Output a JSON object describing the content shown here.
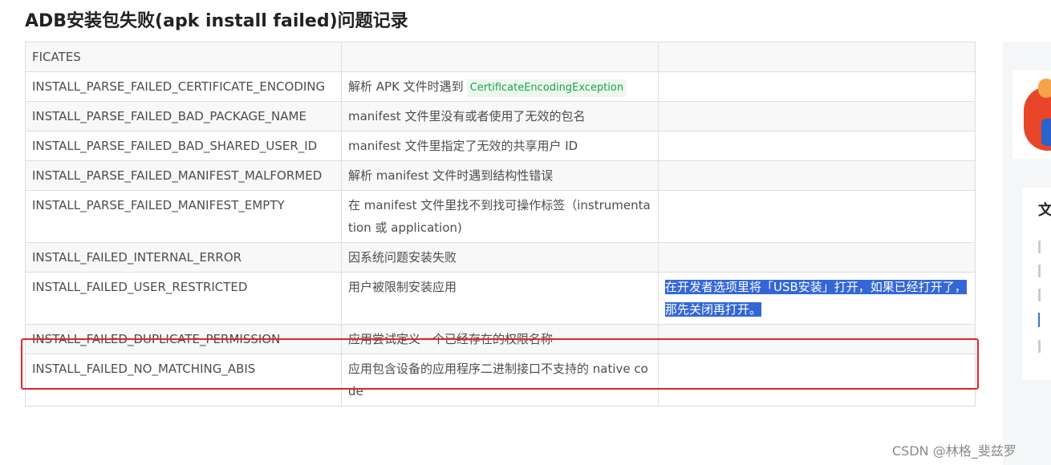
{
  "article": {
    "title": "ADB安装包失败(apk install failed)问题记录"
  },
  "table": {
    "rows": [
      {
        "code": "FICATES",
        "desc": "",
        "desc_code": "",
        "fix": ""
      },
      {
        "code": "INSTALL_PARSE_FAILED_CERTIFICATE_ENCODING",
        "desc": "解析 APK 文件时遇到",
        "desc_code": "CertificateEncodingException",
        "fix": ""
      },
      {
        "code": "INSTALL_PARSE_FAILED_BAD_PACKAGE_NAME",
        "desc": "manifest 文件里没有或者使用了无效的包名",
        "desc_code": "",
        "fix": ""
      },
      {
        "code": "INSTALL_PARSE_FAILED_BAD_SHARED_USER_ID",
        "desc": "manifest 文件里指定了无效的共享用户 ID",
        "desc_code": "",
        "fix": ""
      },
      {
        "code": "INSTALL_PARSE_FAILED_MANIFEST_MALFORMED",
        "desc": "解析 manifest 文件时遇到结构性错误",
        "desc_code": "",
        "fix": ""
      },
      {
        "code": "INSTALL_PARSE_FAILED_MANIFEST_EMPTY",
        "desc": "在 manifest 文件里找不到找可操作标签（instrumentation 或 application)",
        "desc_code": "",
        "fix": ""
      },
      {
        "code": "INSTALL_FAILED_INTERNAL_ERROR",
        "desc": "因系统问题安装失败",
        "desc_code": "",
        "fix": ""
      },
      {
        "code": "INSTALL_FAILED_USER_RESTRICTED",
        "desc": "用户被限制安装应用",
        "desc_code": "",
        "fix": "在开发者选项里将「USB安装」打开，如果已经打开了，那先关闭再打开。"
      },
      {
        "code": "INSTALL_FAILED_DUPLICATE_PERMISSION",
        "desc": "应用尝试定义一个已经存在的权限名称",
        "desc_code": "",
        "fix": ""
      },
      {
        "code": "INSTALL_FAILED_NO_MATCHING_ABIS",
        "desc": "应用包含设备的应用程序二进制接口不支持的 native code",
        "desc_code": "",
        "fix": ""
      }
    ]
  },
  "sidebar": {
    "toc_title": "文"
  },
  "watermark": "CSDN @林格_斐兹罗",
  "colors": {
    "highlight_border": "#e0262e",
    "selection": "#3367d6",
    "code_chip_text": "#1aa34a"
  }
}
